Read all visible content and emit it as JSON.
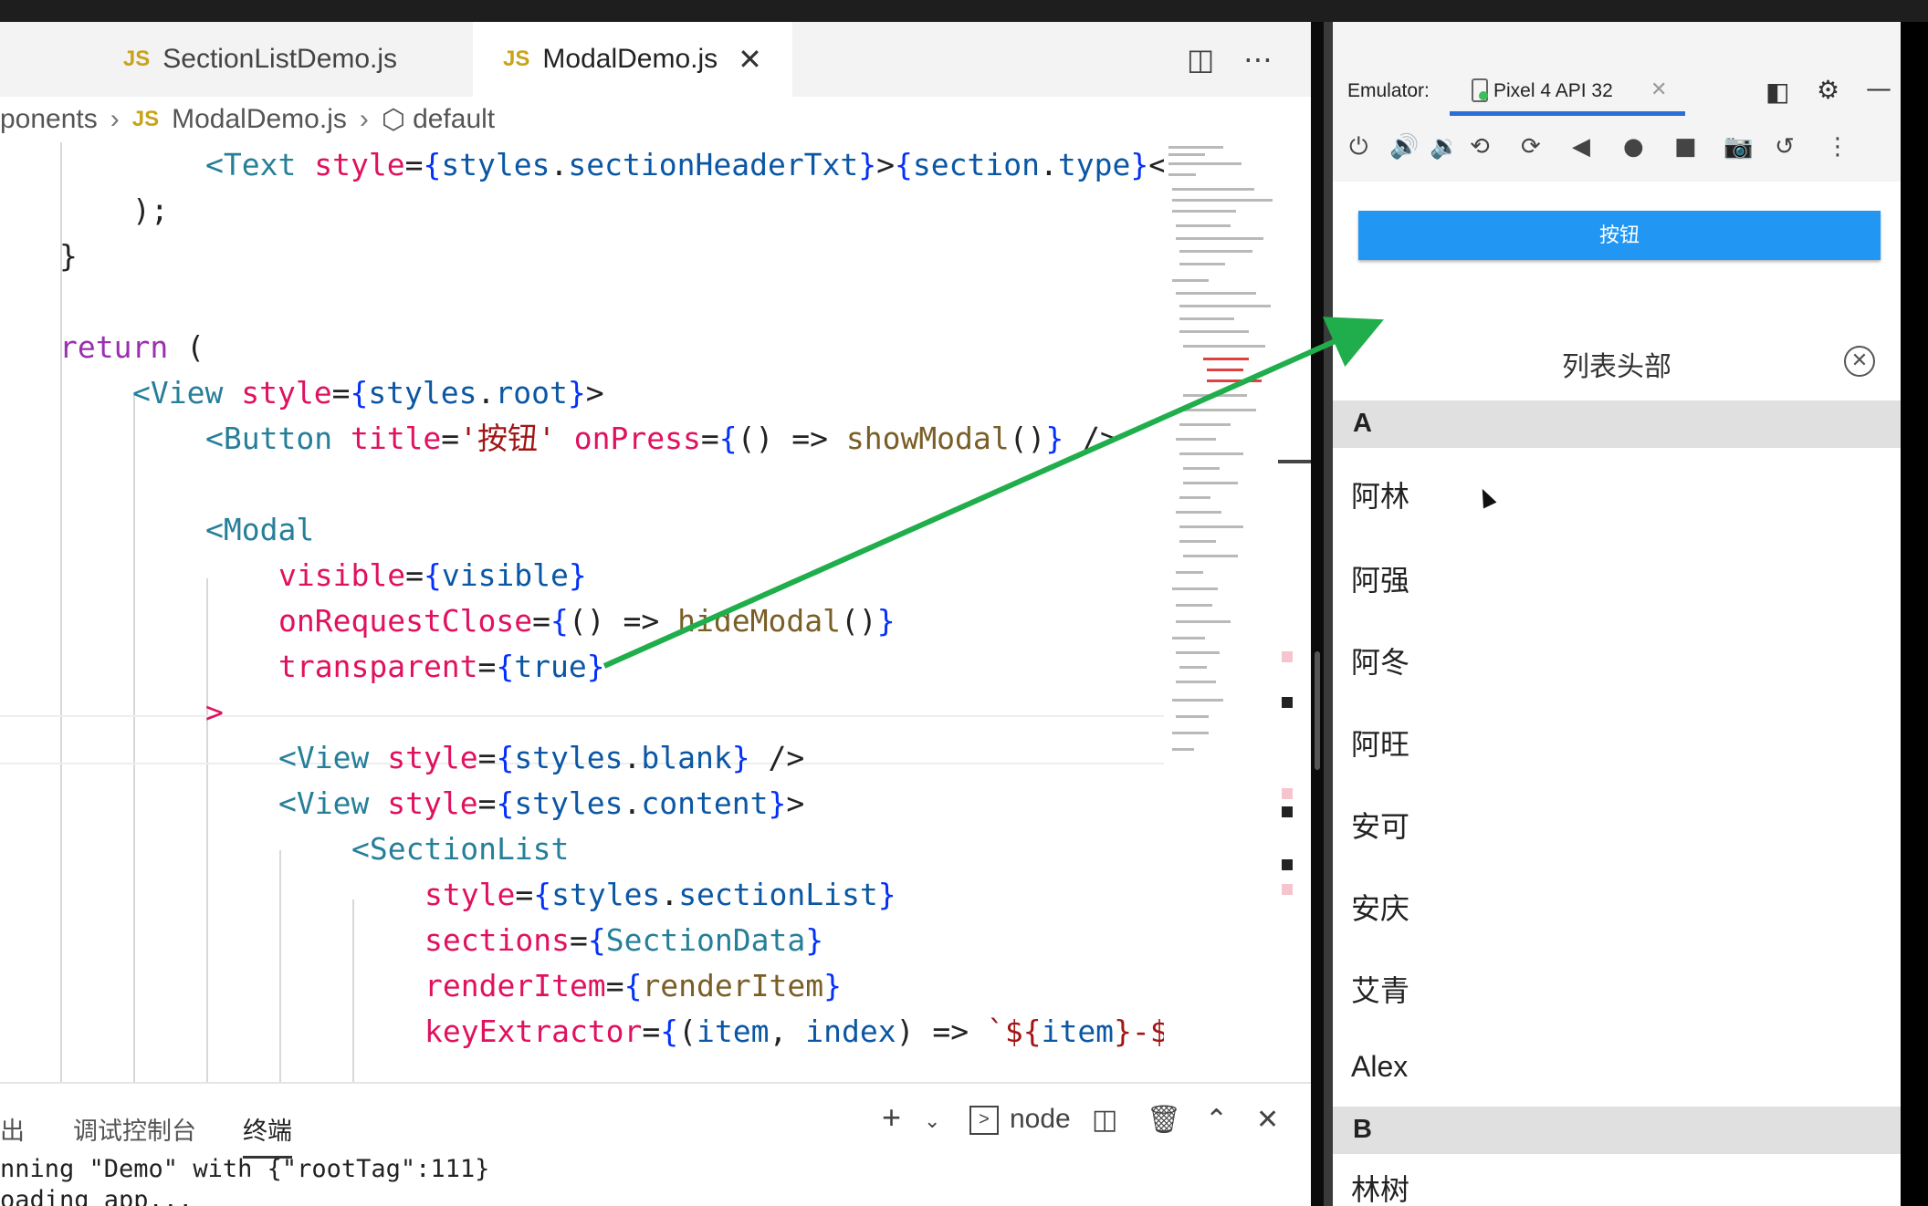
{
  "editor": {
    "tabs": [
      {
        "icon": "JS",
        "label": "SectionListDemo.js"
      },
      {
        "icon": "JS",
        "label": "ModalDemo.js"
      }
    ],
    "breadcrumb": [
      "ponents",
      "ModalDemo.js",
      "default"
    ],
    "code_lines": [
      "<Text style={styles.sectionHeaderTxt}>{section.type}<",
      ");",
      "}",
      "return (",
      "<View style={styles.root}>",
      "<Button title='按钮' onPress={() => showModal()} />",
      "<Modal",
      "visible={visible}",
      "onRequestClose={() => hideModal()}",
      "transparent={true}",
      ">",
      "<View style={styles.blank} />",
      "<View style={styles.content}>",
      "<SectionList",
      "style={styles.sectionList}",
      "sections={SectionData}",
      "renderItem={renderItem}",
      "keyExtractor={(item, index) => `${item}-$"
    ]
  },
  "panel": {
    "tabs": [
      "出",
      "调试控制台",
      "终端"
    ],
    "active_tab": "终端",
    "shell": "node",
    "terminal_lines": [
      "nning \"Demo\" with {\"rootTag\":111}",
      "oading app..."
    ]
  },
  "emulator": {
    "label": "Emulator:",
    "device": "Pixel 4 API 32",
    "app": {
      "button_label": "按钮",
      "list_header": "列表头部",
      "sections": [
        {
          "title": "A",
          "items": [
            "阿林",
            "阿强",
            "阿冬",
            "阿旺",
            "安可",
            "安庆",
            "艾青",
            "Alex"
          ]
        },
        {
          "title": "B",
          "items": [
            "林树"
          ]
        }
      ]
    }
  },
  "colors": {
    "arrow": "#1fae4b",
    "app_button": "#2196f3",
    "device_tab_underline": "#2b6fd6"
  }
}
